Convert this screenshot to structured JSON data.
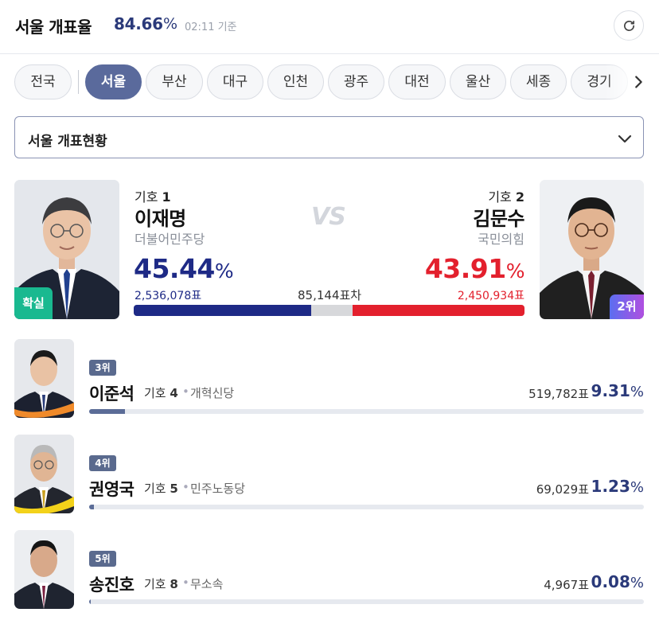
{
  "header": {
    "title": "서울 개표율",
    "rate": "84.66",
    "rate_unit": "%",
    "time": "02:11 기준"
  },
  "tabs": [
    {
      "label": "전국",
      "active": false
    },
    {
      "label": "서울",
      "active": true
    },
    {
      "label": "부산",
      "active": false
    },
    {
      "label": "대구",
      "active": false
    },
    {
      "label": "인천",
      "active": false
    },
    {
      "label": "광주",
      "active": false
    },
    {
      "label": "대전",
      "active": false
    },
    {
      "label": "울산",
      "active": false
    },
    {
      "label": "세종",
      "active": false
    },
    {
      "label": "경기",
      "active": false
    }
  ],
  "dropdown": {
    "label": "서울 개표현황"
  },
  "main": {
    "vs": "VS",
    "diff": "85,144표차",
    "candidates": [
      {
        "num_prefix": "기호 ",
        "num": "1",
        "name": "이재명",
        "party": "더불어민주당",
        "pct": "45.44",
        "pct_unit": "%",
        "votes": "2,536,078표",
        "badge": "확실",
        "color": "#1e2a86",
        "share": 0.4544
      },
      {
        "num_prefix": "기호 ",
        "num": "2",
        "name": "김문수",
        "party": "국민의힘",
        "pct": "43.91",
        "pct_unit": "%",
        "votes": "2,450,934표",
        "badge": "2위",
        "color": "#e3202d",
        "share": 0.4391
      }
    ]
  },
  "others": [
    {
      "rank": "3위",
      "name": "이준석",
      "num_prefix": "기호 ",
      "num": "4",
      "sep": "•",
      "party": "개혁신당",
      "votes": "519,782표",
      "pct": "9.31",
      "pct_unit": "%",
      "share": 0.0931
    },
    {
      "rank": "4위",
      "name": "권영국",
      "num_prefix": "기호 ",
      "num": "5",
      "sep": "•",
      "party": "민주노동당",
      "votes": "69,029표",
      "pct": "1.23",
      "pct_unit": "%",
      "share": 0.0123
    },
    {
      "rank": "5위",
      "name": "송진호",
      "num_prefix": "기호 ",
      "num": "8",
      "sep": "•",
      "party": "무소속",
      "votes": "4,967표",
      "pct": "0.08",
      "pct_unit": "%",
      "share": 0.0008
    }
  ],
  "colors": {
    "accent": "#5a6a9c",
    "rate": "#2b3a7a",
    "sure": "#19b990",
    "bar_fill": "#5b6c97"
  },
  "icons": {
    "refresh": "refresh-icon",
    "next": "chevron-right-icon",
    "dropdown": "chevron-down-icon"
  }
}
